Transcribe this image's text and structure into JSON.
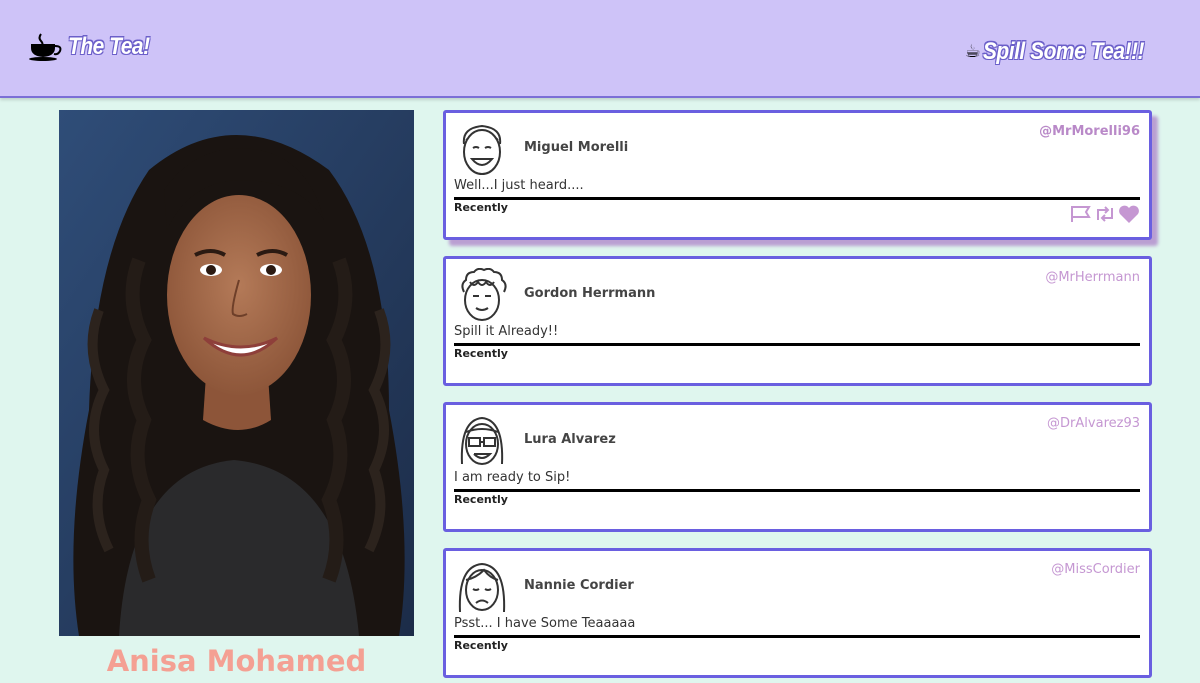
{
  "header": {
    "brand_label": "The Tea!",
    "brand_icon": "teacup-icon",
    "cta_label": "Spill Some Tea!!!",
    "cta_emoji": "☕"
  },
  "profile": {
    "name": "Anisa Mohamed",
    "photo_icon": "profile-photo"
  },
  "colors": {
    "header_bg": "#cec3f8",
    "page_bg": "#dff6ee",
    "card_border": "#6a5fe0",
    "handle": "#c597d2",
    "name_accent": "#f4a093"
  },
  "posts": [
    {
      "author": "Miguel Morelli",
      "handle": "@MrMorelli96",
      "message": "Well...I just heard....",
      "timestamp": "Recently",
      "avatar": "smiling-man-avatar-icon",
      "actions": [
        "flag-icon",
        "retweet-icon",
        "heart-icon"
      ]
    },
    {
      "author": "Gordon Herrmann",
      "handle": "@MrHerrmann",
      "message": "Spill it Already!!",
      "timestamp": "Recently",
      "avatar": "curly-hair-man-avatar-icon"
    },
    {
      "author": "Lura Alvarez",
      "handle": "@DrAlvarez93",
      "message": "I am ready to Sip!",
      "timestamp": "Recently",
      "avatar": "woman-glasses-avatar-icon"
    },
    {
      "author": "Nannie Cordier",
      "handle": "@MissCordier",
      "message": "Psst... I have Some Teaaaaa",
      "timestamp": "Recently",
      "avatar": "sad-woman-avatar-icon"
    }
  ]
}
